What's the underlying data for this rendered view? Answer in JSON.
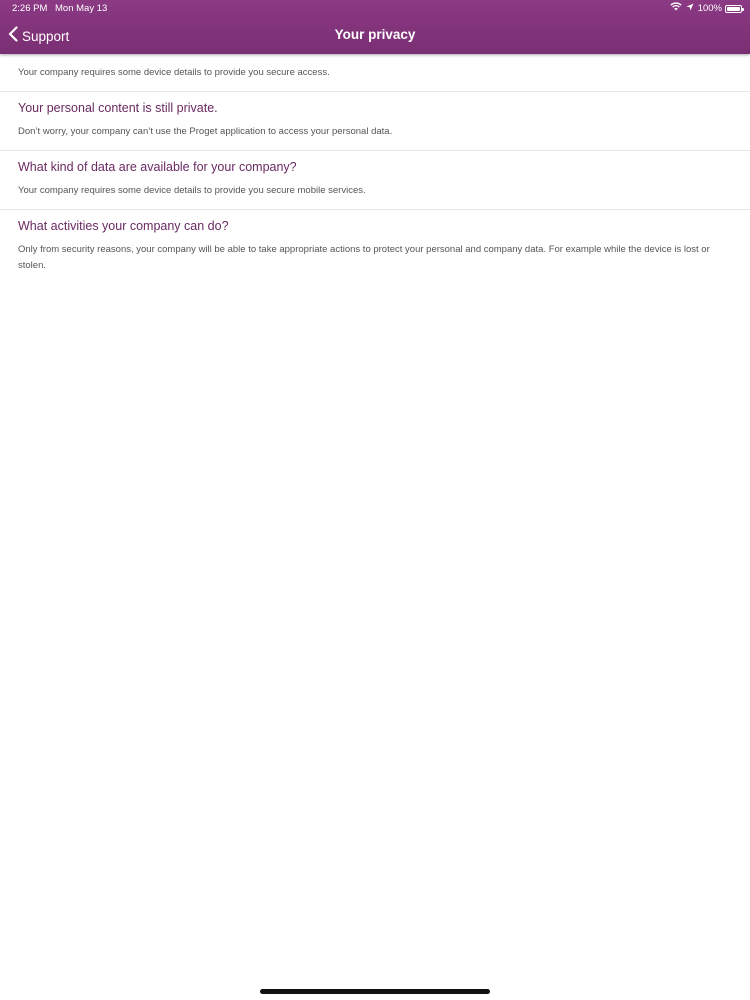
{
  "status_bar": {
    "time": "2:26 PM",
    "date": "Mon May 13",
    "battery": "100%",
    "icons": [
      "wifi-icon",
      "location-icon",
      "battery-icon"
    ]
  },
  "nav": {
    "back_label": "Support",
    "title": "Your privacy"
  },
  "intro": "Your company requires some device details to provide you secure access.",
  "sections": [
    {
      "title": "Your personal content is still private.",
      "body": "Don’t worry, your company can’t use the Proget application to access your personal data."
    },
    {
      "title": "What kind of data are available for your company?",
      "body": "Your company requires some device details to provide you secure mobile services."
    },
    {
      "title": "What activities your company can do?",
      "body": "Only from security reasons, your company will be able to take appropriate actions to protect your personal and company data. For example while the device is lost or stolen."
    }
  ],
  "colors": {
    "header": "#7f3178",
    "section_title": "#6a2a62",
    "body_text": "#555555"
  }
}
